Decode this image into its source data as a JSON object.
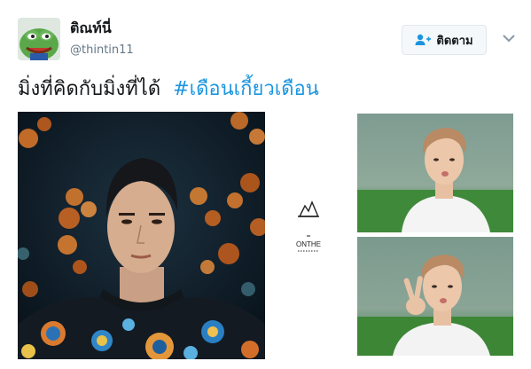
{
  "author": {
    "display_name": "ติณท์นี่",
    "handle": "@thintin11"
  },
  "follow_button": {
    "label": "ติดตาม"
  },
  "tweet": {
    "text": "มิ่งที่คิดกับมิ่งที่ได้",
    "hashtag": "#เดือนเกี้ยวเดือน"
  },
  "media": {
    "logo_text": "ONTHE"
  },
  "colors": {
    "link": "#1b95e0",
    "secondary_text": "#657786",
    "button_border": "#e1e8ed"
  },
  "icons": [
    "frog-avatar",
    "add-user-icon",
    "chevron-down-icon",
    "building-logo-icon"
  ]
}
